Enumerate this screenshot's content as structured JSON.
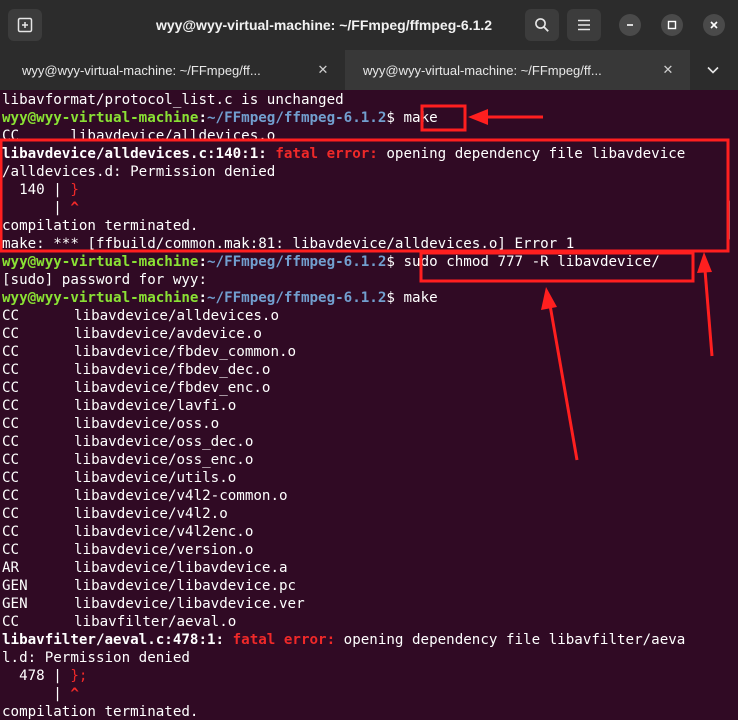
{
  "window": {
    "title": "wyy@wyy-virtual-machine: ~/FFmpeg/ffmpeg-6.1.2"
  },
  "tabs": [
    {
      "label": "wyy@wyy-virtual-machine: ~/FFmpeg/ff...",
      "active": false
    },
    {
      "label": "wyy@wyy-virtual-machine: ~/FFmpeg/ff...",
      "active": true
    }
  ],
  "prompt": {
    "user_host": "wyy@wyy-virtual-machine",
    "path": "~/FFmpeg/ffmpeg-6.1.2",
    "symbol": "$"
  },
  "terminal": {
    "line_protocol": "libavformat/protocol_list.c is unchanged",
    "cmd_make": "make",
    "cc": "CC",
    "cc_alldevices_src": "libavdevice/alldevices.o",
    "err1_file": "libavdevice/alldevices.c:140:1:",
    "fatal_label": "fatal error:",
    "err1_msg": " opening dependency file libavdevice",
    "err1_cont": "/alldevices.d: Permission denied",
    "err1_gutter_num": "  140 | ",
    "err1_code": "}",
    "err1_gutter_blank": "      | ",
    "caret": "^",
    "compilation_terminated": "compilation terminated.",
    "make_error": "make: *** [ffbuild/common.mak:81: libavdevice/alldevices.o] Error 1",
    "cmd_chmod": "sudo chmod 777 -R libavdevice/",
    "sudo_prompt": "[sudo] password for wyy:",
    "build_lines": [
      {
        "tag": "CC",
        "target": "libavdevice/alldevices.o"
      },
      {
        "tag": "CC",
        "target": "libavdevice/avdevice.o"
      },
      {
        "tag": "CC",
        "target": "libavdevice/fbdev_common.o"
      },
      {
        "tag": "CC",
        "target": "libavdevice/fbdev_dec.o"
      },
      {
        "tag": "CC",
        "target": "libavdevice/fbdev_enc.o"
      },
      {
        "tag": "CC",
        "target": "libavdevice/lavfi.o"
      },
      {
        "tag": "CC",
        "target": "libavdevice/oss.o"
      },
      {
        "tag": "CC",
        "target": "libavdevice/oss_dec.o"
      },
      {
        "tag": "CC",
        "target": "libavdevice/oss_enc.o"
      },
      {
        "tag": "CC",
        "target": "libavdevice/utils.o"
      },
      {
        "tag": "CC",
        "target": "libavdevice/v4l2-common.o"
      },
      {
        "tag": "CC",
        "target": "libavdevice/v4l2.o"
      },
      {
        "tag": "CC",
        "target": "libavdevice/v4l2enc.o"
      },
      {
        "tag": "CC",
        "target": "libavdevice/version.o"
      },
      {
        "tag": "AR",
        "target": "libavdevice/libavdevice.a"
      },
      {
        "tag": "GEN",
        "target": "libavdevice/libavdevice.pc"
      },
      {
        "tag": "GEN",
        "target": "libavdevice/libavdevice.ver"
      },
      {
        "tag": "CC",
        "target": "libavfilter/aeval.o"
      }
    ],
    "err2_file": "libavfilter/aeval.c:478:1:",
    "err2_msg": " opening dependency file libavfilter/aeva",
    "err2_cont": "l.d: Permission denied",
    "err2_gutter_num": "  478 | ",
    "err2_code": "};",
    "err2_gutter_blank": "      | "
  },
  "colors": {
    "terminal_bg": "#300a24",
    "prompt_user": "#8ae234",
    "prompt_path": "#729fcf",
    "error_red": "#ef2929",
    "annotation_red": "#ff1f1f"
  },
  "icons": [
    "new-tab-icon",
    "search-icon",
    "hamburger-menu-icon",
    "minimize-icon",
    "maximize-icon",
    "close-icon",
    "tab-close-icon",
    "tab-overflow-chevron-icon"
  ]
}
